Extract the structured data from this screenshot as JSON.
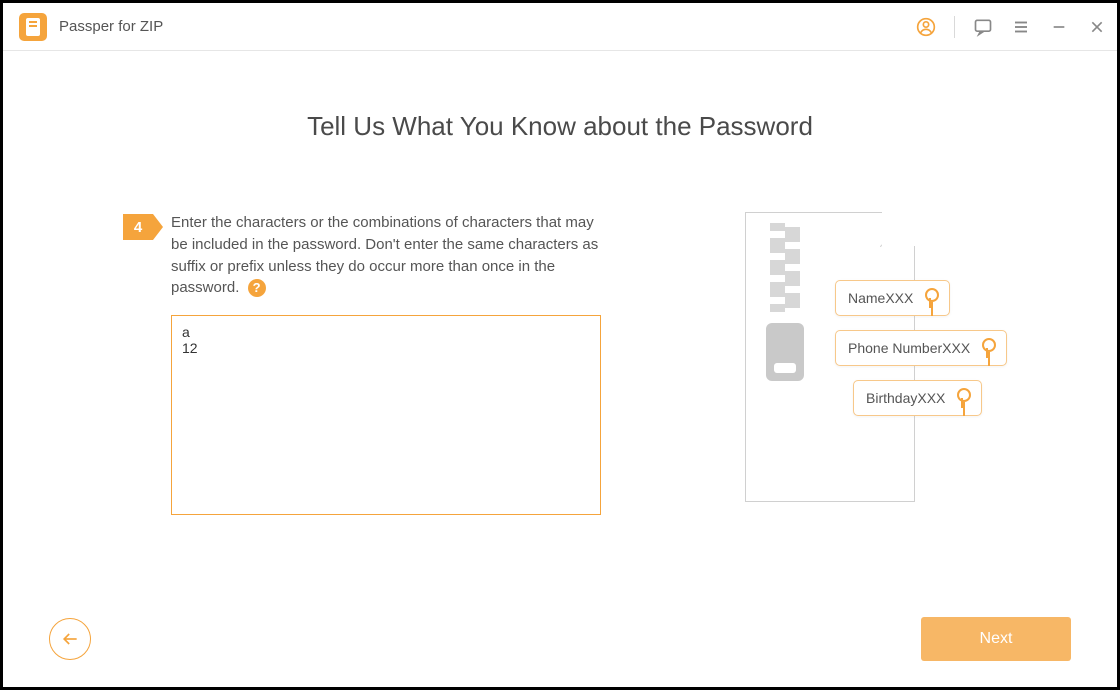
{
  "app": {
    "title": "Passper for ZIP"
  },
  "page": {
    "heading": "Tell Us What You Know about the Password",
    "step_number": "4",
    "step_text": "Enter the characters or the combinations of characters that may be included in the password. Don't enter the same characters as suffix or prefix unless they do occur more than once in the password.",
    "help_symbol": "?",
    "input_value": "a\n12"
  },
  "illustration": {
    "tag1": "NameXXX",
    "tag2": "Phone NumberXXX",
    "tag3": "BirthdayXXX"
  },
  "footer": {
    "next_label": "Next"
  }
}
